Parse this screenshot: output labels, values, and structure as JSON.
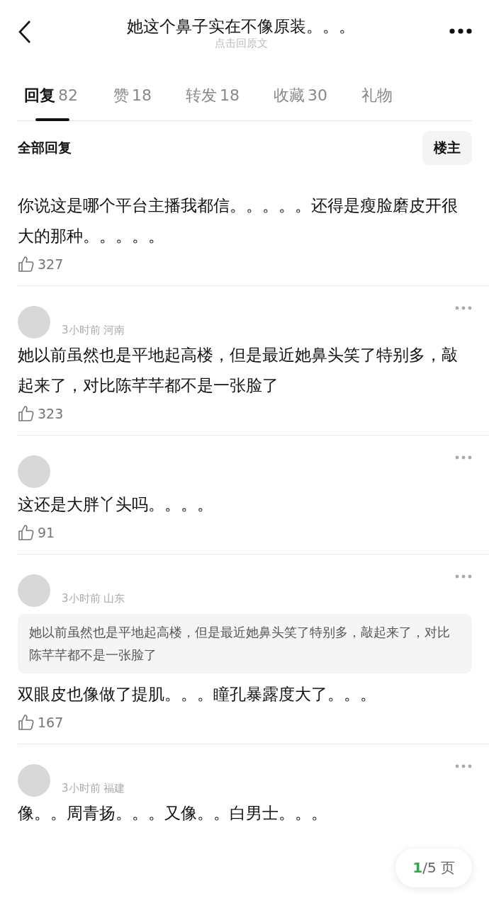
{
  "header": {
    "title": "她这个鼻子实在不像原装。。。",
    "subtitle": "点击回原文"
  },
  "tabs": [
    {
      "label": "回复",
      "count": "82",
      "selected": true
    },
    {
      "label": "赞",
      "count": "18",
      "selected": false
    },
    {
      "label": "转发",
      "count": "18",
      "selected": false
    },
    {
      "label": "收藏",
      "count": "30",
      "selected": false
    },
    {
      "label": "礼物",
      "selected": false
    }
  ],
  "filter": {
    "label": "全部回复",
    "button": "楼主"
  },
  "comments": [
    {
      "text": "你说这是哪个平台主播我都信。。。。。还得是瘦脸磨皮开很大的那种。。。。。",
      "likes": "327"
    },
    {
      "avatar": true,
      "meta": "3小时前 河南",
      "text": "她以前虽然也是平地起高楼，但是最近她鼻头笑了特别多，敲起来了，对比陈芊芊都不是一张脸了",
      "likes": "323"
    },
    {
      "avatar": true,
      "text": "这还是大胖丫头吗。。。。",
      "likes": "91"
    },
    {
      "avatar": true,
      "meta": "3小时前 山东",
      "quote": "她以前虽然也是平地起高楼，但是最近她鼻头笑了特别多，敲起来了，对比陈芊芊都不是一张脸了",
      "text": "双眼皮也像做了提肌。。。瞳孔暴露度大了。。。",
      "likes": "167"
    },
    {
      "avatar": true,
      "meta": "3小时前 福建",
      "text": "像。。周青扬。。。又像。。白男士。。。"
    }
  ],
  "pagination": {
    "current": "1",
    "total": "/5 页"
  }
}
